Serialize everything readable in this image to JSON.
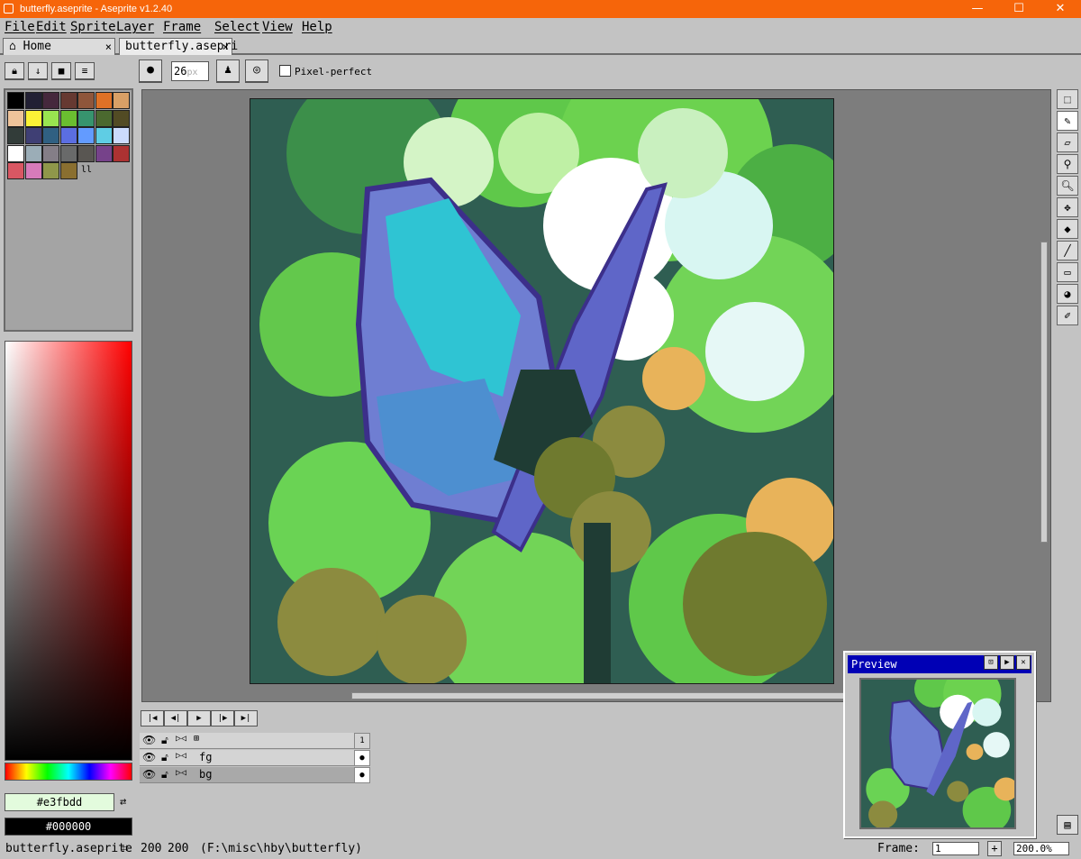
{
  "window": {
    "title": "butterfly.aseprite - Aseprite v1.2.40",
    "minimize": "—",
    "maximize": "☐",
    "close": "✕"
  },
  "menu": [
    "File",
    "Edit",
    "Sprite",
    "Layer",
    "Frame",
    "Select",
    "View",
    "Help"
  ],
  "tabs": [
    {
      "label": "Home",
      "icon": "home-icon",
      "close": "×"
    },
    {
      "label": "butterfly.asepri",
      "close": "×"
    }
  ],
  "layer_buttons": [
    "lock-icon",
    "arrow-down-icon",
    "stop-icon",
    "menu-icon"
  ],
  "context_bar": {
    "brush_size": "26",
    "brush_unit": "px",
    "pixel_perfect_label": "Pixel-perfect",
    "pixel_perfect_checked": false
  },
  "palette": {
    "colors": [
      "#000000",
      "#222034",
      "#45283c",
      "#663931",
      "#8f563b",
      "#df7126",
      "#d9a066",
      "#eec39a",
      "#fbf236",
      "#99e550",
      "#6abe30",
      "#37946e",
      "#4b692f",
      "#524b24",
      "#323c39",
      "#3f3f74",
      "#306082",
      "#5b6ee1",
      "#639bff",
      "#5fcde4",
      "#cbdbfc",
      "#ffffff",
      "#9badb7",
      "#847e87",
      "#696a6a",
      "#595652",
      "#76428a",
      "#ac3232",
      "#d95763",
      "#d77bba",
      "#8f974a",
      "#8a6f30"
    ]
  },
  "colors": {
    "foreground": "#e3fbdd",
    "background": "#000000"
  },
  "tools": [
    "marquee-icon",
    "pencil-icon",
    "eraser-icon",
    "eyedropper-icon",
    "zoom-icon",
    "move-icon",
    "bucket-icon",
    "line-icon",
    "rectangle-icon",
    "contour-icon",
    "blur-icon"
  ],
  "timeline": {
    "controls": [
      "first-frame",
      "prev-frame",
      "play",
      "next-frame",
      "last-frame"
    ],
    "frame_header": "1",
    "layers": [
      {
        "name": "fg",
        "visible": true,
        "locked": false
      },
      {
        "name": "bg",
        "visible": true,
        "locked": false,
        "selected": true
      }
    ]
  },
  "preview": {
    "title": "Preview"
  },
  "status": {
    "filename": "butterfly.aseprite",
    "size_w": "200",
    "size_h": "200",
    "path": "(F:\\misc\\hby\\butterfly)",
    "frame_label": "Frame:",
    "frame_value": "1",
    "zoom": "200.0%"
  }
}
